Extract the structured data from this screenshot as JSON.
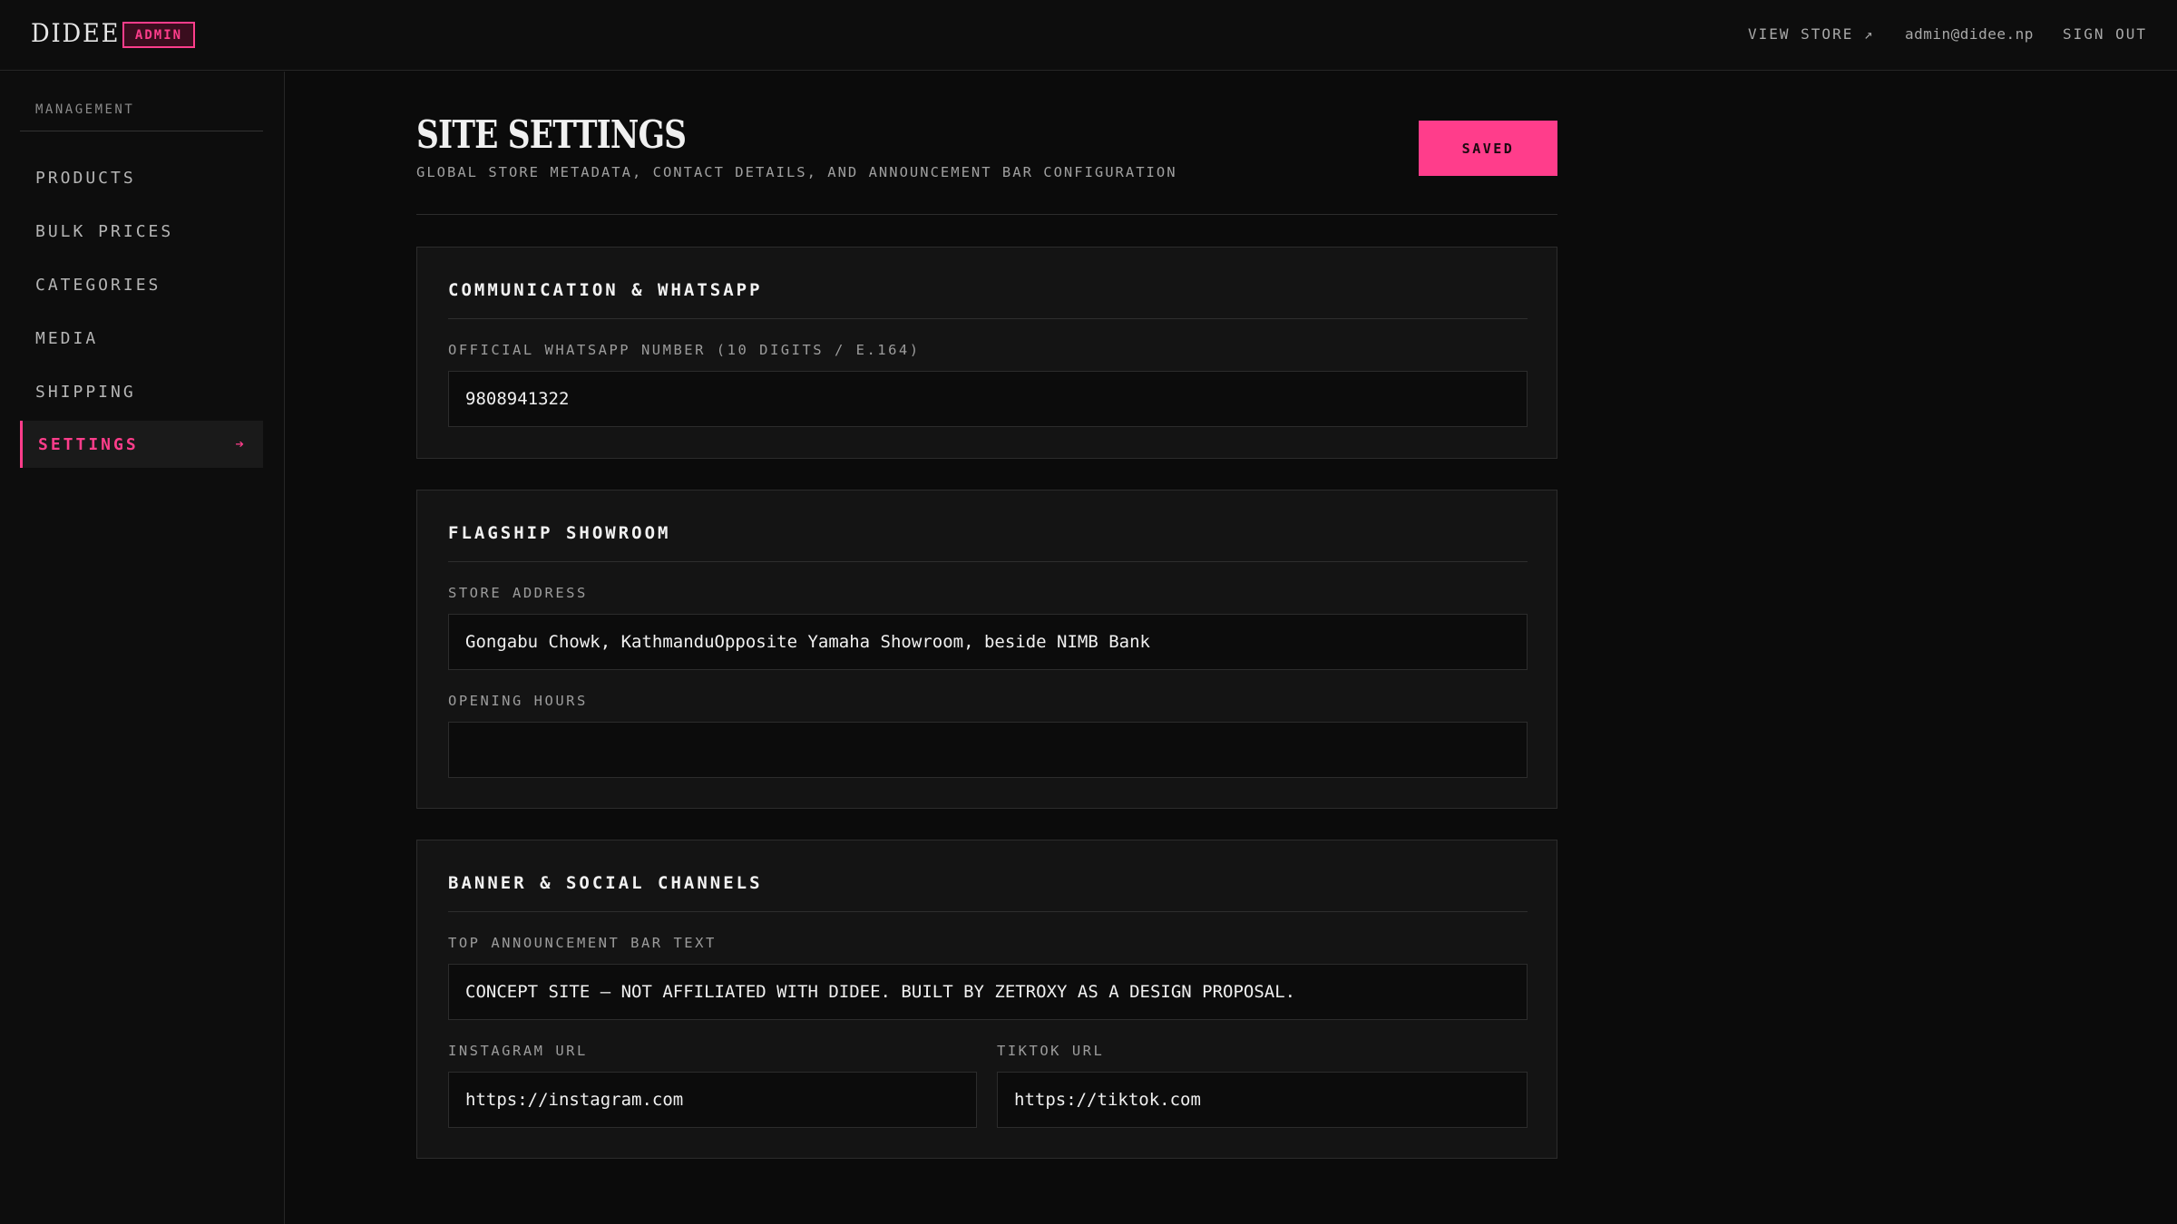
{
  "header": {
    "logo": "DIDEE",
    "badge": "ADMIN",
    "view_store": "VIEW STORE ↗",
    "user_email": "admin@didee.np",
    "sign_out": "SIGN OUT"
  },
  "sidebar": {
    "section_label": "MANAGEMENT",
    "items": [
      {
        "label": "PRODUCTS"
      },
      {
        "label": "BULK PRICES"
      },
      {
        "label": "CATEGORIES"
      },
      {
        "label": "MEDIA"
      },
      {
        "label": "SHIPPING"
      },
      {
        "label": "SETTINGS",
        "active": true,
        "icon": "arrow-right-icon"
      }
    ]
  },
  "page": {
    "title": "SITE SETTINGS",
    "subtitle": "GLOBAL STORE METADATA, CONTACT DETAILS, AND ANNOUNCEMENT BAR CONFIGURATION",
    "save_button": "SAVED"
  },
  "sections": {
    "communication": {
      "title": "COMMUNICATION & WHATSAPP",
      "whatsapp_label": "OFFICIAL WHATSAPP NUMBER (10 DIGITS / E.164)",
      "whatsapp_value": "9808941322"
    },
    "showroom": {
      "title": "FLAGSHIP SHOWROOM",
      "address_label": "STORE ADDRESS",
      "address_value": "Gongabu Chowk, KathmanduOpposite Yamaha Showroom, beside NIMB Bank",
      "hours_label": "OPENING HOURS",
      "hours_value": ""
    },
    "banner": {
      "title": "BANNER & SOCIAL CHANNELS",
      "announcement_label": "TOP ANNOUNCEMENT BAR TEXT",
      "announcement_value": "CONCEPT SITE — NOT AFFILIATED WITH DIDEE. BUILT BY ZETROXY AS A DESIGN PROPOSAL.",
      "instagram_label": "INSTAGRAM URL",
      "instagram_value": "https://instagram.com",
      "tiktok_label": "TIKTOK URL",
      "tiktok_value": "https://tiktok.com"
    }
  },
  "colors": {
    "accent": "#ff3d8b",
    "background": "#0b0b0b",
    "card": "#141414"
  }
}
